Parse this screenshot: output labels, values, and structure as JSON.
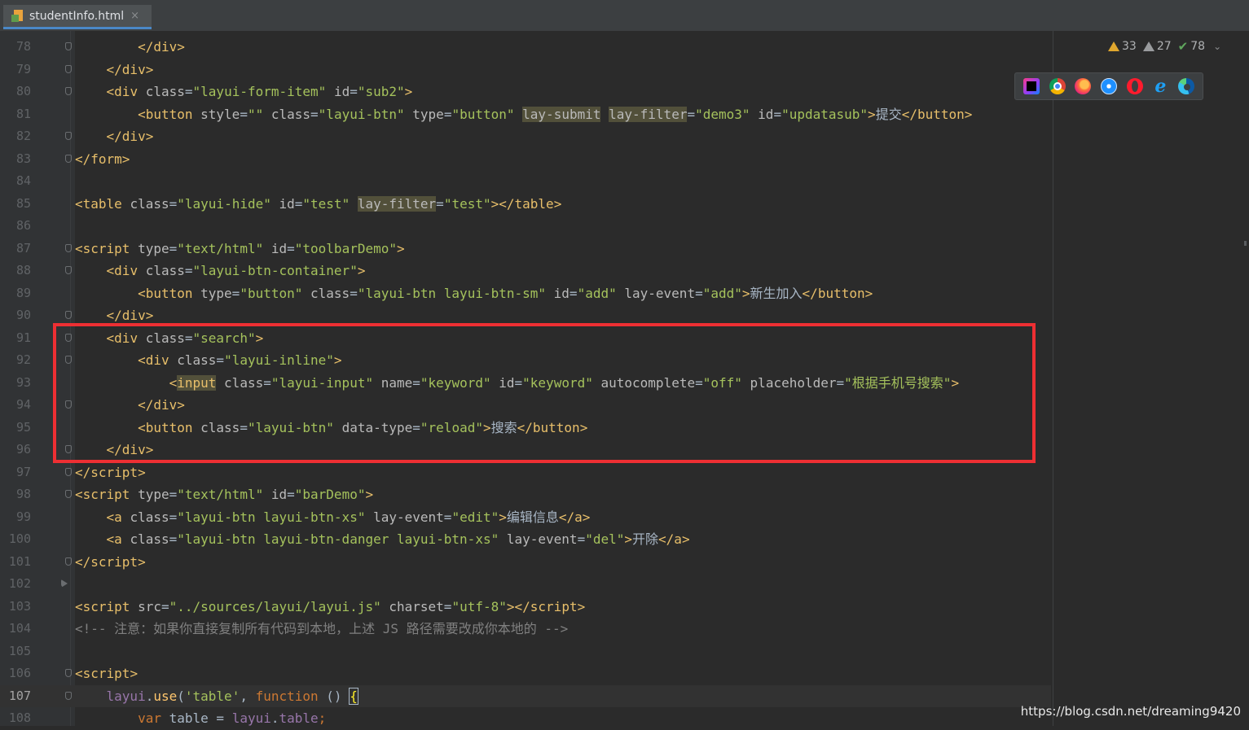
{
  "tab": {
    "filename": "studentInfo.html",
    "close_glyph": "×"
  },
  "inspections": {
    "warnings": "33",
    "weak_warnings": "27",
    "typos": "78",
    "chevron": "⌄"
  },
  "browsers": [
    "intellij-idea-icon",
    "chrome-icon",
    "firefox-icon",
    "safari-icon",
    "opera-icon",
    "internet-explorer-icon",
    "edge-icon"
  ],
  "current_line": 107,
  "lines": [
    {
      "n": "78"
    },
    {
      "n": "79"
    },
    {
      "n": "80"
    },
    {
      "n": "81"
    },
    {
      "n": "82"
    },
    {
      "n": "83"
    },
    {
      "n": "84"
    },
    {
      "n": "85"
    },
    {
      "n": "86"
    },
    {
      "n": "87"
    },
    {
      "n": "88"
    },
    {
      "n": "89"
    },
    {
      "n": "90"
    },
    {
      "n": "91"
    },
    {
      "n": "92"
    },
    {
      "n": "93"
    },
    {
      "n": "94"
    },
    {
      "n": "95"
    },
    {
      "n": "96"
    },
    {
      "n": "97"
    },
    {
      "n": "98"
    },
    {
      "n": "99"
    },
    {
      "n": "100"
    },
    {
      "n": "101"
    },
    {
      "n": "102"
    },
    {
      "n": "103"
    },
    {
      "n": "104"
    },
    {
      "n": "105"
    },
    {
      "n": "106"
    },
    {
      "n": "107"
    },
    {
      "n": "108"
    }
  ],
  "text": {
    "div": "div",
    "form": "form",
    "table": "table",
    "script": "script",
    "button": "button",
    "input": "input",
    "a": "a",
    "class": "class",
    "id": "id",
    "type": "type",
    "style": "style",
    "name": "name",
    "src": "src",
    "charset": "charset",
    "lay_submit": "lay-submit",
    "lay_filter": "lay-filter",
    "lay_event": "lay-event",
    "autocomplete": "autocomplete",
    "placeholder": "placeholder",
    "data_type": "data-type",
    "v_form_item": "\"layui-form-item\"",
    "v_sub2": "\"sub2\"",
    "v_empty": "\"\"",
    "v_layui_btn": "\"layui-btn\"",
    "v_button": "\"button\"",
    "v_demo3": "\"demo3\"",
    "v_updatasub": "\"updatasub\"",
    "t_submit": "提交",
    "v_layui_hide": "\"layui-hide\"",
    "v_test": "\"test\"",
    "v_text_html": "\"text/html\"",
    "v_toolbarDemo": "\"toolbarDemo\"",
    "v_btn_container": "\"layui-btn-container\"",
    "v_btn_sm": "\"layui-btn layui-btn-sm\"",
    "v_add": "\"add\"",
    "t_add": "新生加入",
    "v_search": "\"search\"",
    "v_inline": "\"layui-inline\"",
    "v_layui_input": "\"layui-input\"",
    "v_keyword": "\"keyword\"",
    "v_off": "\"off\"",
    "v_placeholder": "\"根据手机号搜索\"",
    "v_reload": "\"reload\"",
    "t_search": "搜索",
    "v_barDemo": "\"barDemo\"",
    "v_btn_xs": "\"layui-btn layui-btn-xs\"",
    "v_edit": "\"edit\"",
    "t_edit": "编辑信息",
    "v_btn_danger_xs": "\"layui-btn layui-btn-danger layui-btn-xs\"",
    "v_del": "\"del\"",
    "t_del": "开除",
    "v_layui_js": "\"../sources/layui/layui.js\"",
    "v_utf8": "\"utf-8\"",
    "comment_104": "<!-- 注意：如果你直接复制所有代码到本地，上述 JS 路径需要改成你本地的 -->",
    "layui": "layui",
    "use": "use",
    "s_table": "'table'",
    "function": "function",
    "var": "var",
    "table_var": "table",
    "table_prop": "table"
  },
  "watermark": "https://blog.csdn.net/dreaming9420",
  "colors": {
    "highlight_box": "#ee2f33",
    "background": "#2b2b2b",
    "tag": "#e8bf6a",
    "string": "#a5c25c"
  }
}
